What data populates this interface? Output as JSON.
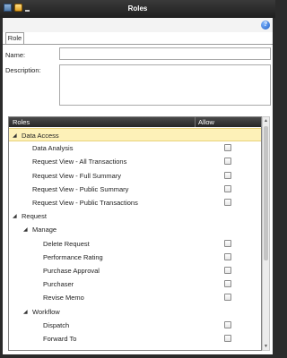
{
  "window": {
    "title": "Roles"
  },
  "tabs": [
    {
      "label": "Role"
    }
  ],
  "form": {
    "name_label": "Name:",
    "name_value": "",
    "description_label": "Description:",
    "description_value": ""
  },
  "grid": {
    "columns": {
      "roles": "Roles",
      "allow": "Allow"
    },
    "rows": [
      {
        "label": "Data Access",
        "level": 0,
        "expandable": true,
        "expanded": true,
        "checkbox": false,
        "selected": true
      },
      {
        "label": "Data Analysis",
        "level": 1,
        "expandable": false,
        "checkbox": true,
        "checked": false
      },
      {
        "label": "Request View - All Transactions",
        "level": 1,
        "expandable": false,
        "checkbox": true,
        "checked": false
      },
      {
        "label": "Request View - Full Summary",
        "level": 1,
        "expandable": false,
        "checkbox": true,
        "checked": false
      },
      {
        "label": "Request View - Public Summary",
        "level": 1,
        "expandable": false,
        "checkbox": true,
        "checked": false
      },
      {
        "label": "Request View - Public Transactions",
        "level": 1,
        "expandable": false,
        "checkbox": true,
        "checked": false
      },
      {
        "label": "Request",
        "level": 0,
        "expandable": true,
        "expanded": true,
        "checkbox": false
      },
      {
        "label": "Manage",
        "level": 1,
        "expandable": true,
        "expanded": true,
        "checkbox": false
      },
      {
        "label": "Delete Request",
        "level": 2,
        "expandable": false,
        "checkbox": true,
        "checked": false
      },
      {
        "label": "Performance Rating",
        "level": 2,
        "expandable": false,
        "checkbox": true,
        "checked": false
      },
      {
        "label": "Purchase Approval",
        "level": 2,
        "expandable": false,
        "checkbox": true,
        "checked": false
      },
      {
        "label": "Purchaser",
        "level": 2,
        "expandable": false,
        "checkbox": true,
        "checked": false
      },
      {
        "label": "Revise Memo",
        "level": 2,
        "expandable": false,
        "checkbox": true,
        "checked": false
      },
      {
        "label": "Workflow",
        "level": 1,
        "expandable": true,
        "expanded": true,
        "checkbox": false
      },
      {
        "label": "Dispatch",
        "level": 2,
        "expandable": false,
        "checkbox": true,
        "checked": false
      },
      {
        "label": "Forward To",
        "level": 2,
        "expandable": false,
        "checkbox": true,
        "checked": false
      }
    ]
  },
  "icons": {
    "app": "window-icon",
    "folder": "folder-icon",
    "help": "help-icon",
    "expanded": "triangle-expanded-icon"
  }
}
